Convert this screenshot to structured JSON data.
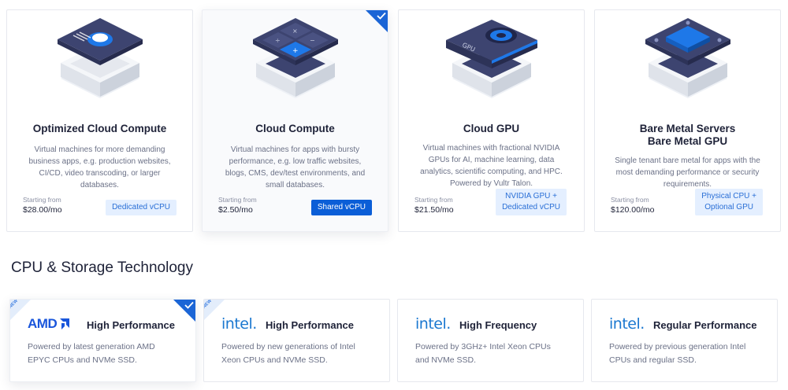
{
  "plans": [
    {
      "title": "Optimized Cloud Compute",
      "description": "Virtual machines for more demanding business apps, e.g. production websites, CI/CD, video transcoding, or larger databases.",
      "starting_label": "Starting from",
      "price": "$28.00/mo",
      "badge": "Dedicated vCPU",
      "icon": "optimized-compute-icon"
    },
    {
      "title": "Cloud Compute",
      "description": "Virtual machines for apps with bursty performance, e.g. low traffic websites, blogs, CMS, dev/test environments, and small databases.",
      "starting_label": "Starting from",
      "price": "$2.50/mo",
      "badge": "Shared vCPU",
      "icon": "cloud-compute-icon",
      "selected": true
    },
    {
      "title": "Cloud GPU",
      "description": "Virtual machines with fractional NVIDIA GPUs for AI, machine learning, data analytics, scientific computing, and HPC. Powered by Vultr Talon.",
      "starting_label": "Starting from",
      "price": "$21.50/mo",
      "badge_line1": "NVIDIA GPU +",
      "badge_line2": "Dedicated vCPU",
      "icon": "gpu-icon",
      "chip_label": "GPU"
    },
    {
      "title_line1": "Bare Metal Servers",
      "title_line2": "Bare Metal GPU",
      "description": "Single tenant bare metal for apps with the most demanding performance or security requirements.",
      "starting_label": "Starting from",
      "price": "$120.00/mo",
      "badge_line1": "Physical CPU +",
      "badge_line2": "Optional GPU",
      "icon": "bare-metal-icon"
    }
  ],
  "section_title": "CPU & Storage Technology",
  "technologies": [
    {
      "brand": "AMD",
      "name": "High Performance",
      "description_line1": "Powered by latest generation AMD",
      "description_line2": "EPYC CPUs and NVMe SSD.",
      "ribbon": "NEW",
      "selected": true
    },
    {
      "brand": "intel.",
      "name": "High Performance",
      "description_line1": "Powered by new generations of Intel",
      "description_line2": "Xeon CPUs and NVMe SSD.",
      "ribbon": "NEW"
    },
    {
      "brand": "intel.",
      "name": "High Frequency",
      "description_line1": "Powered by 3GHz+ Intel Xeon CPUs",
      "description_line2": "and NVMe SSD."
    },
    {
      "brand": "intel.",
      "name": "Regular Performance",
      "description_line1": "Powered by previous generation Intel",
      "description_line2": "CPUs and regular SSD."
    }
  ],
  "colors": {
    "accent": "#0b5ed7",
    "badge_bg": "#e4efff",
    "badge_text": "#2a6fd6",
    "amd": "#1a56db",
    "intel": "#1b78d0"
  }
}
